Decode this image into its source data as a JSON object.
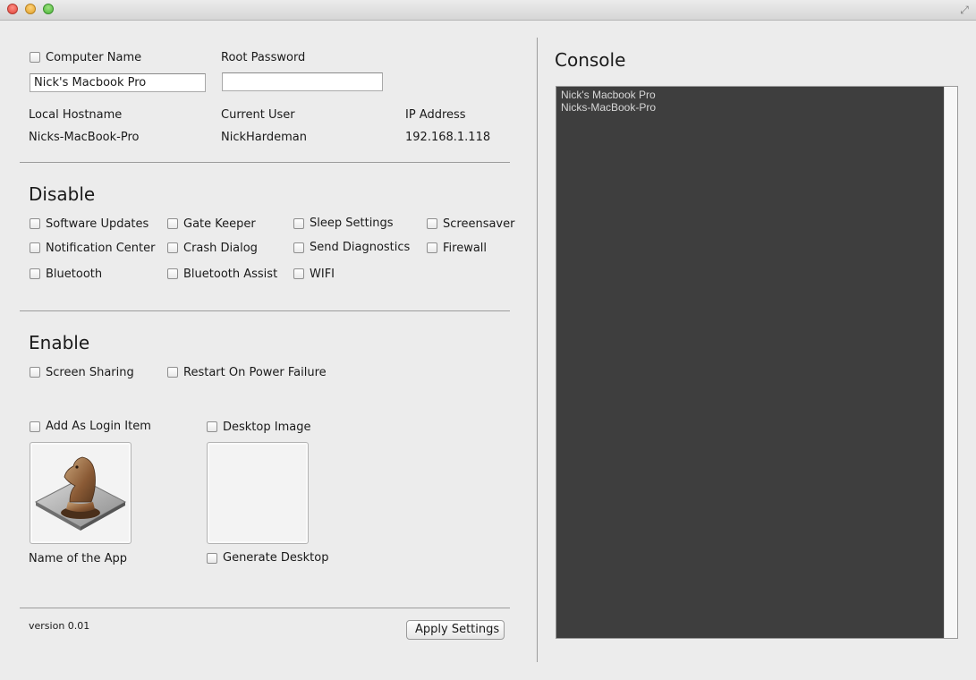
{
  "window": {
    "controls": [
      "close",
      "minimize",
      "zoom"
    ],
    "fullscreen_icon": "fullscreen-icon"
  },
  "general": {
    "computer_name_label": "Computer Name",
    "computer_name_value": "Nick's Macbook Pro",
    "root_password_label": "Root Password",
    "root_password_value": "",
    "local_hostname_label": "Local Hostname",
    "local_hostname_value": "Nicks-MacBook-Pro",
    "current_user_label": "Current User",
    "current_user_value": "NickHardeman",
    "ip_address_label": "IP Address",
    "ip_address_value": "192.168.1.118"
  },
  "disable": {
    "heading": "Disable",
    "options": [
      "Software Updates",
      "Gate Keeper",
      "Sleep Settings",
      "Screensaver",
      "Notification Center",
      "Crash Dialog",
      "Send Diagnostics",
      "Firewall",
      "Bluetooth",
      "Bluetooth Assist",
      "WIFI"
    ]
  },
  "enable": {
    "heading": "Enable",
    "options": [
      "Screen Sharing",
      "Restart On Power Failure"
    ]
  },
  "login_item": {
    "label": "Add As Login Item",
    "app_icon": "chess-knight-app-icon",
    "app_name": "Name of the App"
  },
  "desktop": {
    "image_label": "Desktop Image",
    "generate_label": "Generate Desktop"
  },
  "footer": {
    "version": "version 0.01",
    "apply_button": "Apply Settings"
  },
  "console": {
    "heading": "Console",
    "lines": [
      "Nick's Macbook Pro",
      "Nicks-MacBook-Pro"
    ]
  }
}
